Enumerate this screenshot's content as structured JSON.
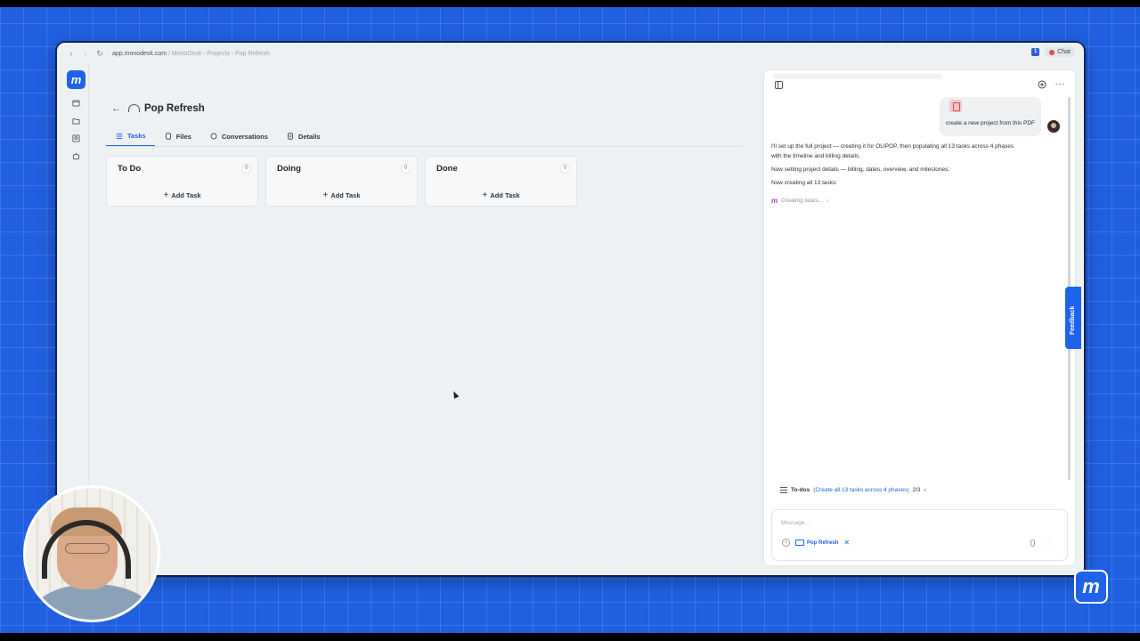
{
  "browser": {
    "url_domain": "app.monodesk.com",
    "url_path": " / MonoDesk - Projects - Pop Refresh",
    "chat_label": "Chat"
  },
  "brand": {
    "logo_glyph": "m"
  },
  "project": {
    "title": "Pop Refresh"
  },
  "tabs": [
    {
      "label": "Tasks",
      "icon": "list-icon",
      "active": true
    },
    {
      "label": "Files",
      "icon": "files-icon",
      "active": false
    },
    {
      "label": "Conversations",
      "icon": "chat-bubble-icon",
      "active": false
    },
    {
      "label": "Details",
      "icon": "document-icon",
      "active": false
    }
  ],
  "board": {
    "add_task_label": "Add Task",
    "columns": [
      {
        "title": "To Do",
        "count": "0"
      },
      {
        "title": "Doing",
        "count": "0"
      },
      {
        "title": "Done",
        "count": "0"
      }
    ]
  },
  "chat": {
    "user_message": "create a new project from this PDF",
    "assistant_paragraphs": [
      "I'll set up the full project — creating it for OLIPOP, then populating all 13 tasks across 4 phases with the timeline and billing details.",
      "Now setting project details — billing, dates, overview, and milestones:",
      "Now creating all 13 tasks:"
    ],
    "status": "Creating tasks...",
    "todos_label": "To-dos",
    "todos_link": "(Create all 13 tasks across 4 phases)",
    "todos_progress": "2/3",
    "input_placeholder": "Message...",
    "context_chip": "Pop Refresh"
  },
  "feedback": {
    "label": "Feedback"
  },
  "colors": {
    "accent": "#1e63e9",
    "background": "#1f5fe0",
    "pdf": "#d24b4b"
  }
}
